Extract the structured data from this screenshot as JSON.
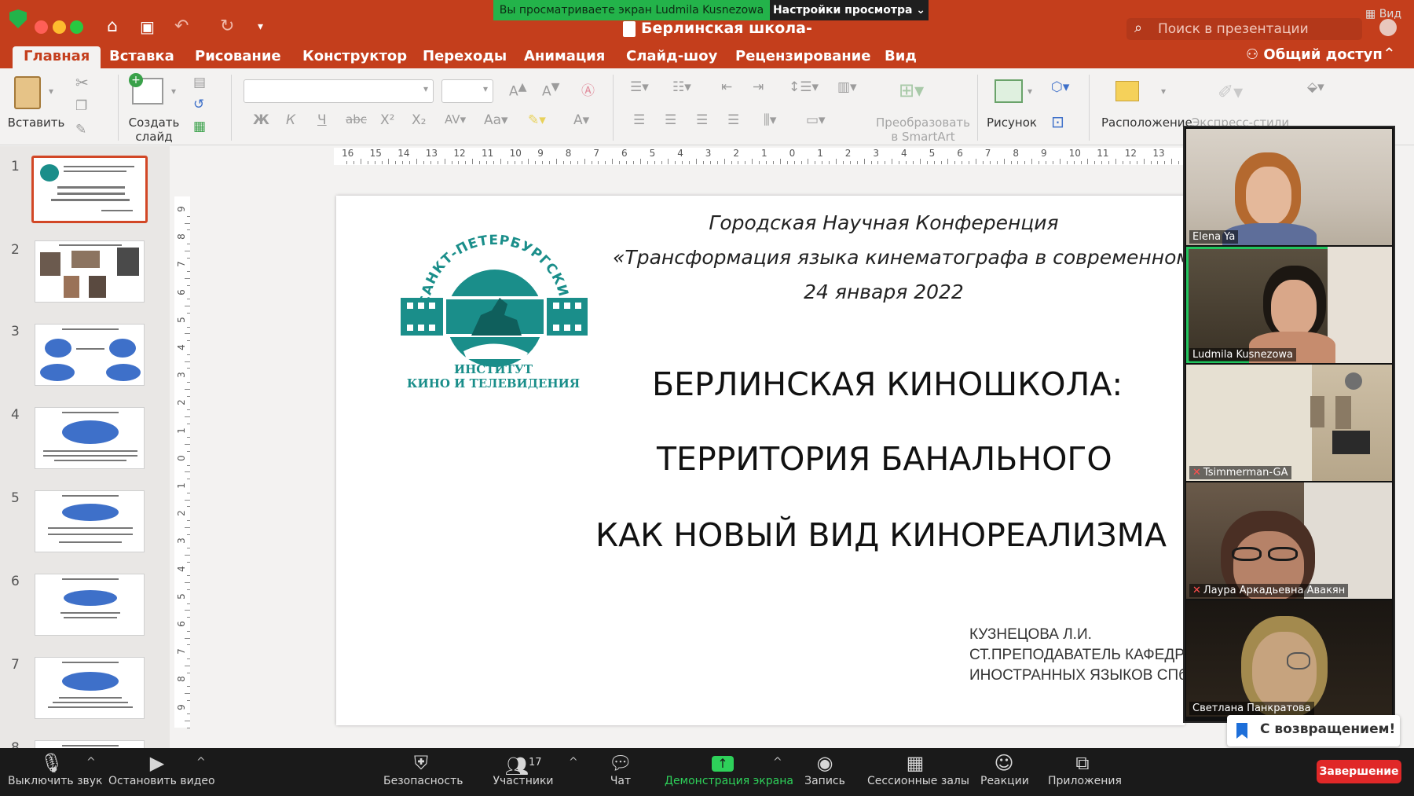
{
  "zoom": {
    "share_banner": "Вы просматриваете экран Ludmila Kusnezowa",
    "view_options": "Настройки просмотра ⌄",
    "view_button": "Вид",
    "toolbar": {
      "mute": "Выключить звук",
      "stop_video": "Остановить видео",
      "security": "Безопасность",
      "participants": "Участники",
      "participants_count": "17",
      "chat": "Чат",
      "share_screen": "Демонстрация экрана",
      "record": "Запись",
      "breakout": "Сессионные залы",
      "reactions": "Реакции",
      "apps": "Приложения",
      "end": "Завершение"
    },
    "toast": "С возвращением!",
    "participants": [
      {
        "name": "Elena Ya",
        "muted": false
      },
      {
        "name": "Ludmila Kusnezowa",
        "muted": false
      },
      {
        "name": "Tsimmerman-GA",
        "muted": true
      },
      {
        "name": "Лаура Аркадьевна Авакян",
        "muted": true
      },
      {
        "name": "Светлана Панкратова",
        "muted": false
      }
    ]
  },
  "powerpoint": {
    "title": "Берлинская школа-",
    "search_placeholder": "Поиск в презентации",
    "share_label": "Общий доступ",
    "tabs": [
      "Главная",
      "Вставка",
      "Рисование",
      "Конструктор",
      "Переходы",
      "Анимация",
      "Слайд-шоу",
      "Рецензирование",
      "Вид"
    ],
    "active_tab": "Главная",
    "ribbon": {
      "paste": "Вставить",
      "new_slide_1": "Создать",
      "new_slide_2": "слайд",
      "convert_1": "Преобразовать",
      "convert_2": "в SmartArt",
      "picture": "Рисунок",
      "arrange": "Расположение",
      "quick_styles": "Экспресс-стили"
    },
    "thumbnail_numbers": [
      "1",
      "2",
      "3",
      "4",
      "5",
      "6",
      "7",
      "8"
    ],
    "ruler_h": [
      "16",
      "15",
      "14",
      "13",
      "12",
      "11",
      "10",
      "9",
      "8",
      "7",
      "6",
      "5",
      "4",
      "3",
      "2",
      "1",
      "0",
      "1",
      "2",
      "3",
      "4",
      "5",
      "6",
      "7",
      "8",
      "9",
      "10",
      "11",
      "12",
      "13"
    ],
    "ruler_v": [
      "9",
      "8",
      "7",
      "6",
      "5",
      "4",
      "3",
      "2",
      "1",
      "0",
      "1",
      "2",
      "3",
      "4",
      "5",
      "6",
      "7",
      "8",
      "9"
    ],
    "slide": {
      "conference_line1": "Городская Научная Конференция",
      "conference_line2": "«Трансформация языка кинематографа в современном",
      "conference_date": "24 января 2022",
      "title_line1": "БЕРЛИНСКАЯ КИНОШКОЛА:",
      "title_line2": "ТЕРРИТОРИЯ БАНАЛЬНОГО",
      "title_line3": "КАК НОВЫЙ ВИД КИНОРЕАЛИЗМА",
      "author_line1": "КУЗНЕЦОВА Л.И.",
      "author_line2": "СТ.ПРЕПОДАВАТЕЛЬ КАФЕДРЫ",
      "author_line3": "ИНОСТРАННЫХ ЯЗЫКОВ СПбГИКиТ",
      "logo_arc_text": "САНКТ-ПЕТЕРБУРГСКИЙ ГОСУДАРСТВЕННЫЙ",
      "logo_institute_1": "ИНСТИТУТ",
      "logo_institute_2": "КИНО И ТЕЛЕВИДЕНИЯ"
    }
  },
  "colors": {
    "ppt_accent": "#c43e1c",
    "logo_teal": "#1a8e8a",
    "zoom_green": "#23b34a",
    "end_red": "#e02828"
  }
}
